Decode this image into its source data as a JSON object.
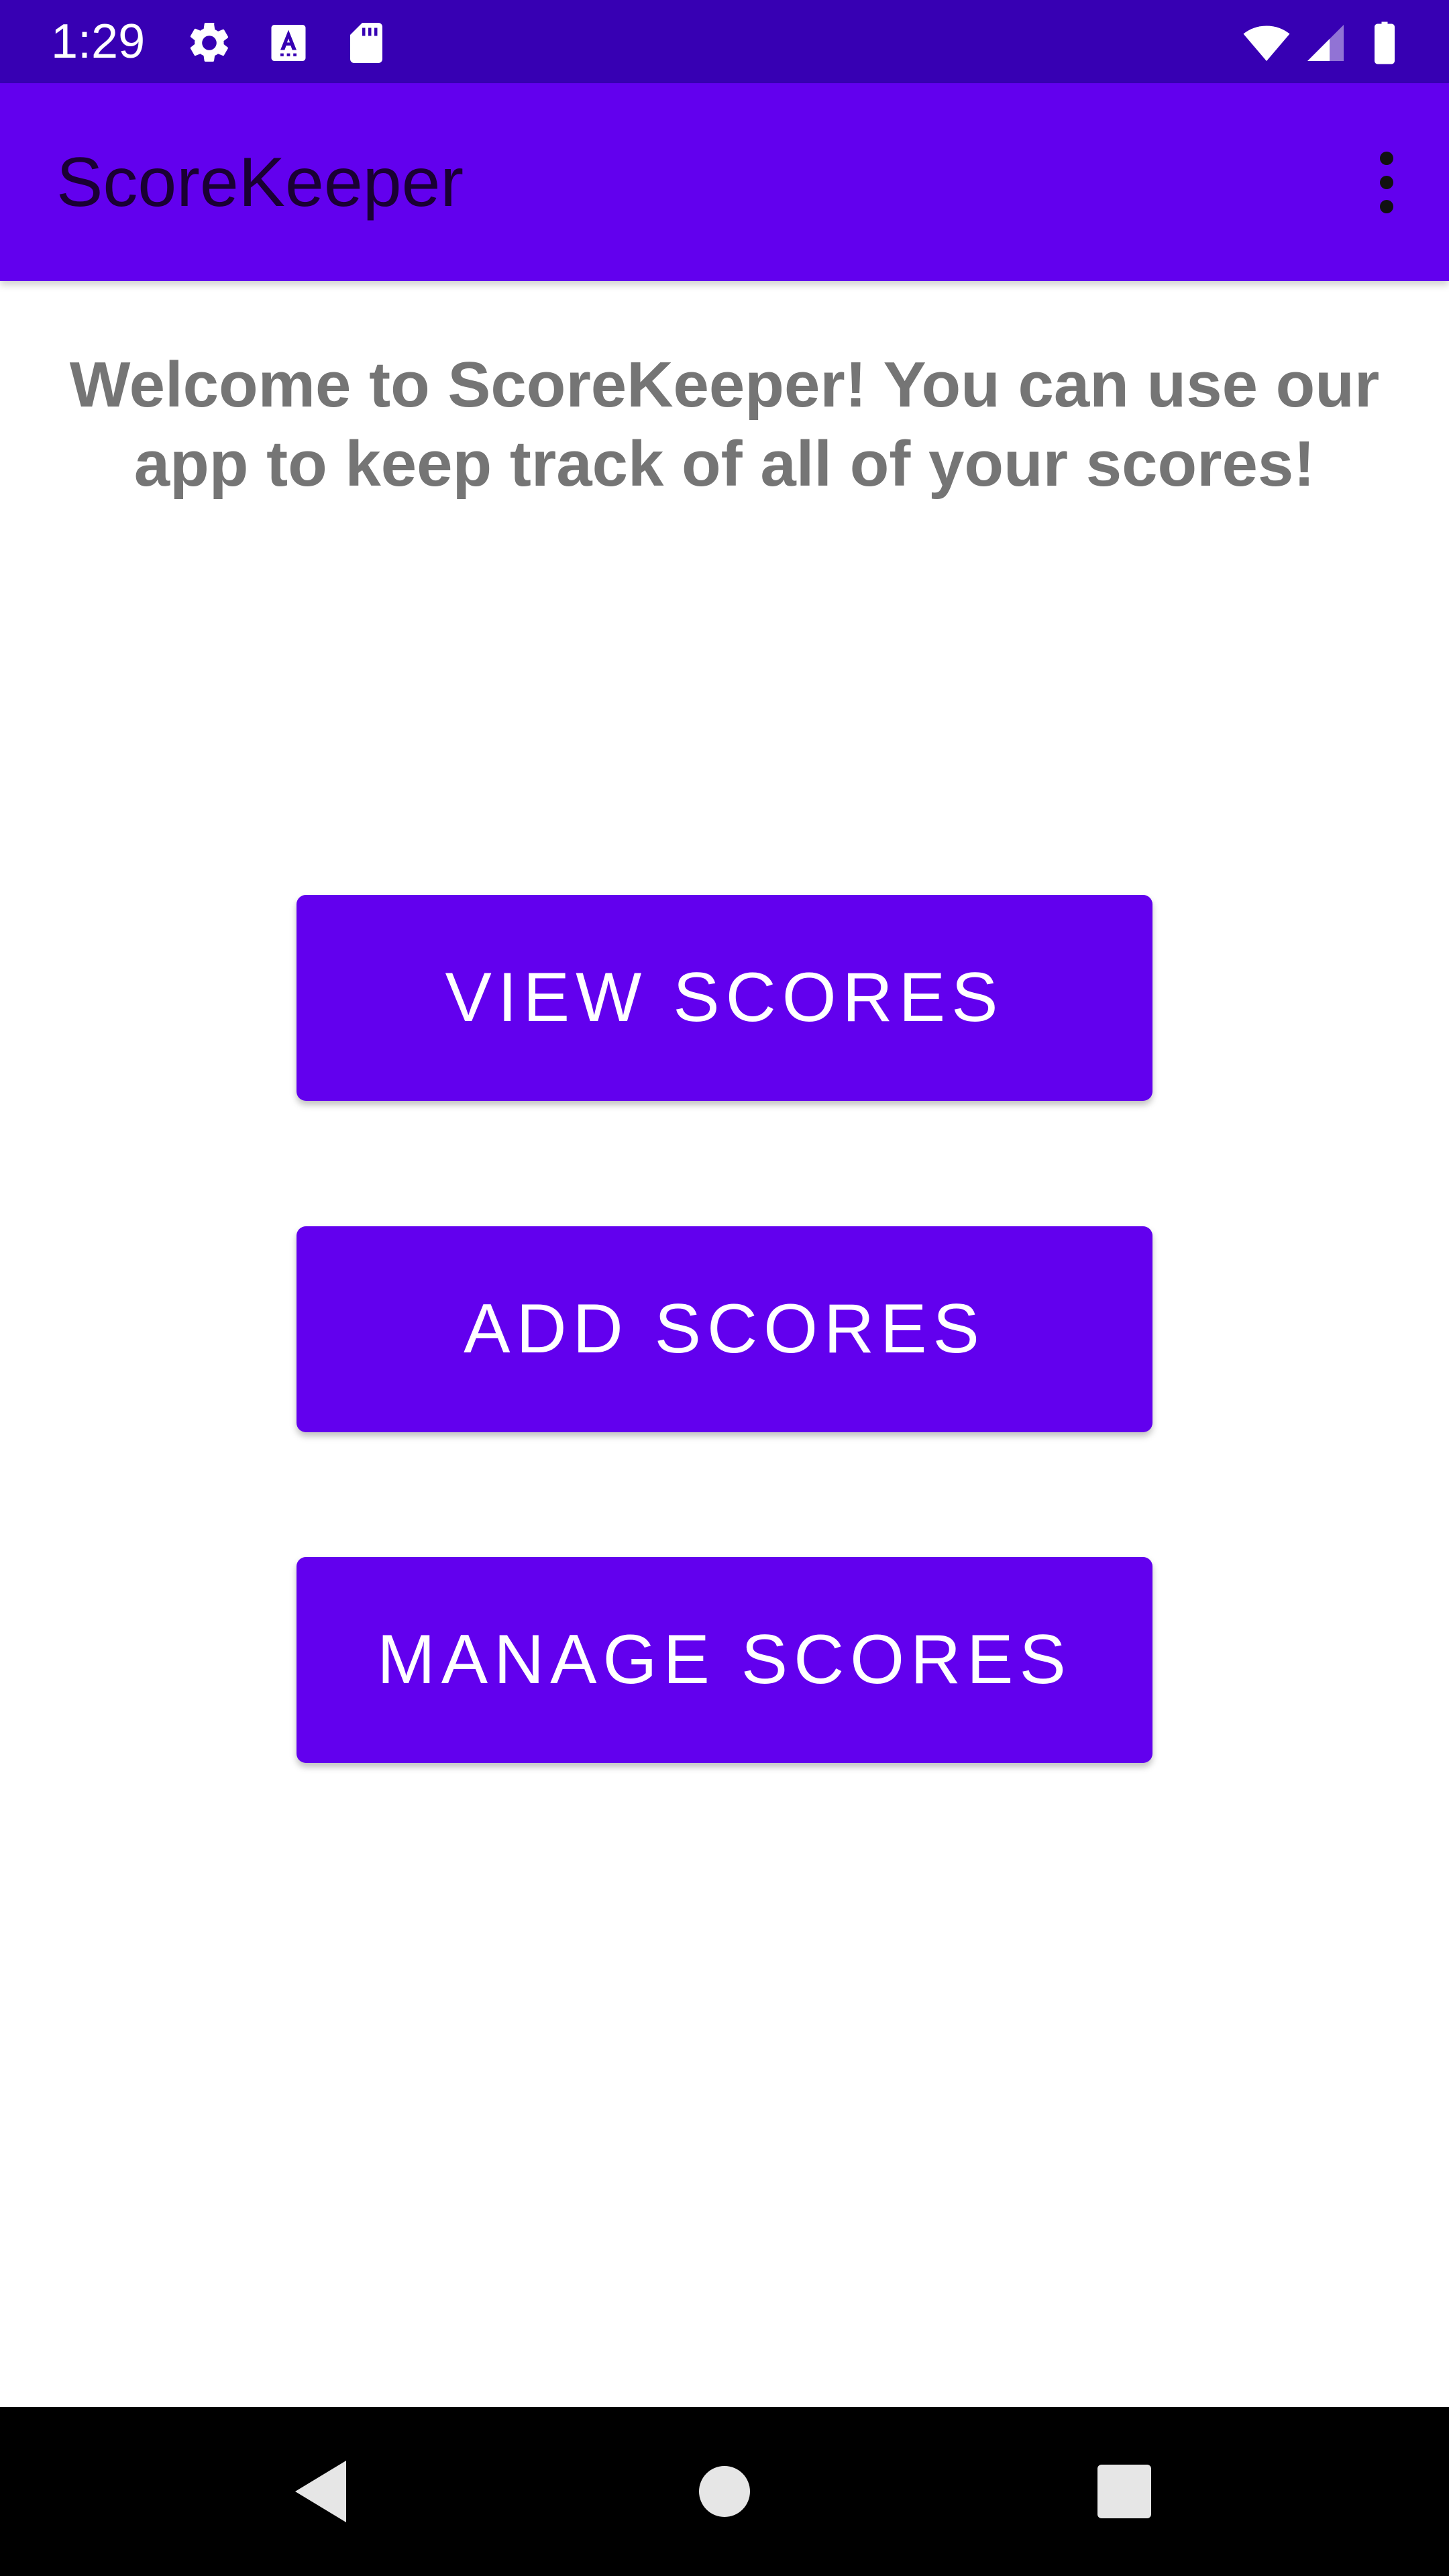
{
  "status_bar": {
    "time": "1:29",
    "icons": [
      "settings-gear-icon",
      "accessibility-a-icon",
      "sd-card-icon",
      "wifi-icon",
      "cell-signal-icon",
      "battery-icon"
    ]
  },
  "app_bar": {
    "title": "ScoreKeeper",
    "overflow_icon": "more-vert-icon"
  },
  "main": {
    "welcome_text": "Welcome to ScoreKeeper! You can use our app to keep track of all of your scores!",
    "buttons": [
      {
        "label": "VIEW SCORES"
      },
      {
        "label": "ADD SCORES"
      },
      {
        "label": "MANAGE SCORES"
      }
    ]
  },
  "nav_bar": {
    "icons": [
      "back-icon",
      "home-icon",
      "recents-icon"
    ]
  },
  "colors": {
    "status_bar": "#3700b3",
    "primary": "#6200ee",
    "welcome_text": "#757575",
    "nav_bar": "#000000"
  }
}
